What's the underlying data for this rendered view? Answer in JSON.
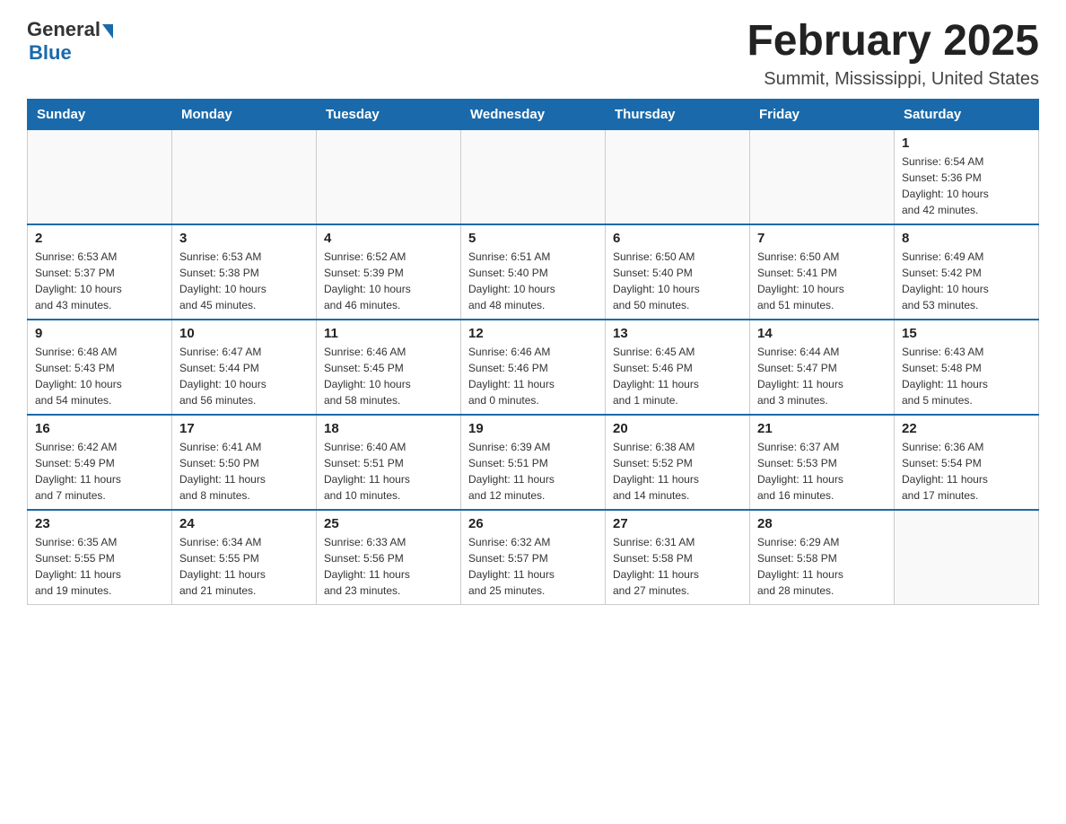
{
  "logo": {
    "general": "General",
    "blue": "Blue"
  },
  "title": "February 2025",
  "location": "Summit, Mississippi, United States",
  "days_of_week": [
    "Sunday",
    "Monday",
    "Tuesday",
    "Wednesday",
    "Thursday",
    "Friday",
    "Saturday"
  ],
  "weeks": [
    [
      {
        "day": "",
        "info": ""
      },
      {
        "day": "",
        "info": ""
      },
      {
        "day": "",
        "info": ""
      },
      {
        "day": "",
        "info": ""
      },
      {
        "day": "",
        "info": ""
      },
      {
        "day": "",
        "info": ""
      },
      {
        "day": "1",
        "info": "Sunrise: 6:54 AM\nSunset: 5:36 PM\nDaylight: 10 hours\nand 42 minutes."
      }
    ],
    [
      {
        "day": "2",
        "info": "Sunrise: 6:53 AM\nSunset: 5:37 PM\nDaylight: 10 hours\nand 43 minutes."
      },
      {
        "day": "3",
        "info": "Sunrise: 6:53 AM\nSunset: 5:38 PM\nDaylight: 10 hours\nand 45 minutes."
      },
      {
        "day": "4",
        "info": "Sunrise: 6:52 AM\nSunset: 5:39 PM\nDaylight: 10 hours\nand 46 minutes."
      },
      {
        "day": "5",
        "info": "Sunrise: 6:51 AM\nSunset: 5:40 PM\nDaylight: 10 hours\nand 48 minutes."
      },
      {
        "day": "6",
        "info": "Sunrise: 6:50 AM\nSunset: 5:40 PM\nDaylight: 10 hours\nand 50 minutes."
      },
      {
        "day": "7",
        "info": "Sunrise: 6:50 AM\nSunset: 5:41 PM\nDaylight: 10 hours\nand 51 minutes."
      },
      {
        "day": "8",
        "info": "Sunrise: 6:49 AM\nSunset: 5:42 PM\nDaylight: 10 hours\nand 53 minutes."
      }
    ],
    [
      {
        "day": "9",
        "info": "Sunrise: 6:48 AM\nSunset: 5:43 PM\nDaylight: 10 hours\nand 54 minutes."
      },
      {
        "day": "10",
        "info": "Sunrise: 6:47 AM\nSunset: 5:44 PM\nDaylight: 10 hours\nand 56 minutes."
      },
      {
        "day": "11",
        "info": "Sunrise: 6:46 AM\nSunset: 5:45 PM\nDaylight: 10 hours\nand 58 minutes."
      },
      {
        "day": "12",
        "info": "Sunrise: 6:46 AM\nSunset: 5:46 PM\nDaylight: 11 hours\nand 0 minutes."
      },
      {
        "day": "13",
        "info": "Sunrise: 6:45 AM\nSunset: 5:46 PM\nDaylight: 11 hours\nand 1 minute."
      },
      {
        "day": "14",
        "info": "Sunrise: 6:44 AM\nSunset: 5:47 PM\nDaylight: 11 hours\nand 3 minutes."
      },
      {
        "day": "15",
        "info": "Sunrise: 6:43 AM\nSunset: 5:48 PM\nDaylight: 11 hours\nand 5 minutes."
      }
    ],
    [
      {
        "day": "16",
        "info": "Sunrise: 6:42 AM\nSunset: 5:49 PM\nDaylight: 11 hours\nand 7 minutes."
      },
      {
        "day": "17",
        "info": "Sunrise: 6:41 AM\nSunset: 5:50 PM\nDaylight: 11 hours\nand 8 minutes."
      },
      {
        "day": "18",
        "info": "Sunrise: 6:40 AM\nSunset: 5:51 PM\nDaylight: 11 hours\nand 10 minutes."
      },
      {
        "day": "19",
        "info": "Sunrise: 6:39 AM\nSunset: 5:51 PM\nDaylight: 11 hours\nand 12 minutes."
      },
      {
        "day": "20",
        "info": "Sunrise: 6:38 AM\nSunset: 5:52 PM\nDaylight: 11 hours\nand 14 minutes."
      },
      {
        "day": "21",
        "info": "Sunrise: 6:37 AM\nSunset: 5:53 PM\nDaylight: 11 hours\nand 16 minutes."
      },
      {
        "day": "22",
        "info": "Sunrise: 6:36 AM\nSunset: 5:54 PM\nDaylight: 11 hours\nand 17 minutes."
      }
    ],
    [
      {
        "day": "23",
        "info": "Sunrise: 6:35 AM\nSunset: 5:55 PM\nDaylight: 11 hours\nand 19 minutes."
      },
      {
        "day": "24",
        "info": "Sunrise: 6:34 AM\nSunset: 5:55 PM\nDaylight: 11 hours\nand 21 minutes."
      },
      {
        "day": "25",
        "info": "Sunrise: 6:33 AM\nSunset: 5:56 PM\nDaylight: 11 hours\nand 23 minutes."
      },
      {
        "day": "26",
        "info": "Sunrise: 6:32 AM\nSunset: 5:57 PM\nDaylight: 11 hours\nand 25 minutes."
      },
      {
        "day": "27",
        "info": "Sunrise: 6:31 AM\nSunset: 5:58 PM\nDaylight: 11 hours\nand 27 minutes."
      },
      {
        "day": "28",
        "info": "Sunrise: 6:29 AM\nSunset: 5:58 PM\nDaylight: 11 hours\nand 28 minutes."
      },
      {
        "day": "",
        "info": ""
      }
    ]
  ]
}
